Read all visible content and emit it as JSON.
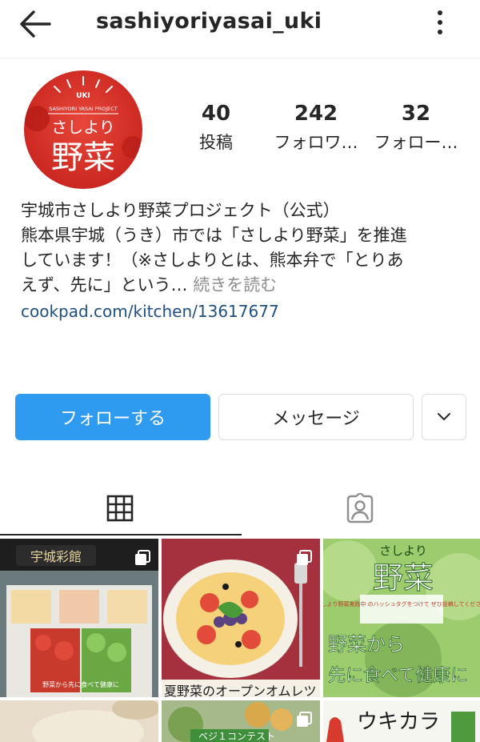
{
  "header": {
    "username": "sashiyoriyasai_uki",
    "back_icon": "arrow-left-icon",
    "menu_icon": "more-vertical-icon"
  },
  "profile": {
    "avatar": {
      "top_text": "UKI",
      "project_text": "SASHIYORI YASAI PROJECT",
      "line1": "さしより",
      "line2": "野菜",
      "bg_color": "#e0352d"
    },
    "stats": [
      {
        "value": "40",
        "label": "投稿"
      },
      {
        "value": "242",
        "label": "フォロワ…"
      },
      {
        "value": "32",
        "label": "フォロー…"
      }
    ]
  },
  "bio": {
    "name": "宇城市さしより野菜プロジェクト（公式）",
    "line1": "熊本県宇城（うき）市では「さしより野菜」を推進",
    "line2": "しています！（※さしよりとは、熊本弁で「とりあ",
    "line3": "えず、先に」という…",
    "more": " 続きを読む",
    "link": "cookpad.com/kitchen/13617677"
  },
  "actions": {
    "follow_label": "フォローする",
    "message_label": "メッセージ",
    "follow_color": "#2f9bf0"
  },
  "tabs": [
    {
      "name": "grid",
      "icon": "grid-icon",
      "active": true
    },
    {
      "name": "tagged",
      "icon": "tagged-person-icon",
      "active": false
    }
  ],
  "posts": [
    {
      "sign_text": "宇城彩館",
      "poster_text": "野菜から先に食べて健康に"
    },
    {
      "caption": "夏野菜のオープンオムレツ"
    },
    {
      "title": "さしより",
      "big": "野菜",
      "notice": "#さしより野菜実践中\nのハッシュタグをつけて\nぜひ投稿してください！",
      "slogan1": "野菜から",
      "slogan2": "先に食べて健康に"
    },
    {
      "caption": ""
    },
    {
      "caption": "ベジ１コンテスト"
    },
    {
      "caption": "ウキカラ"
    }
  ]
}
